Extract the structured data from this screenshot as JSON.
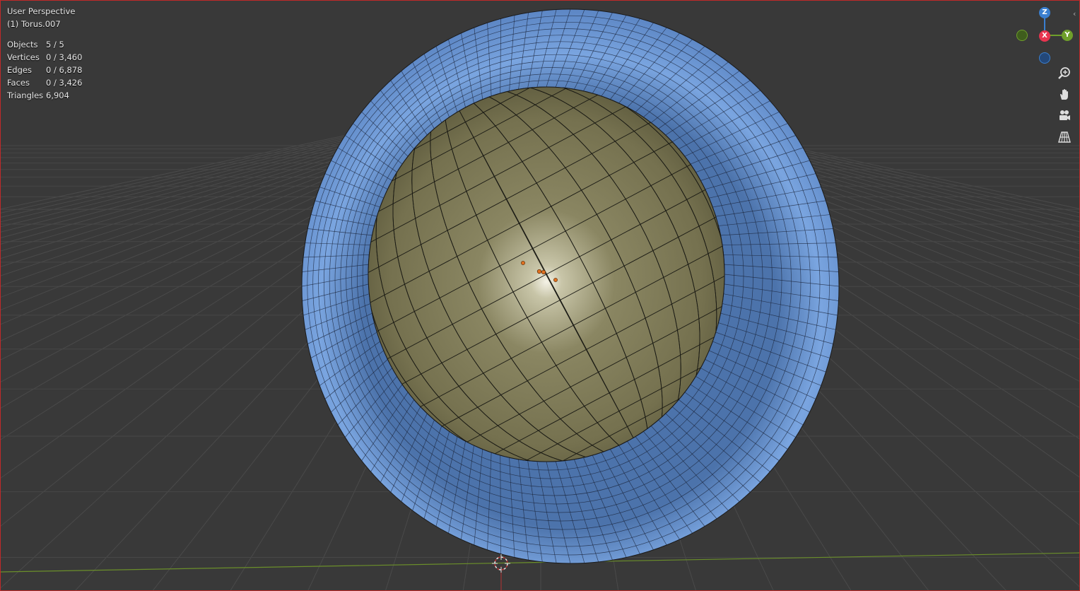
{
  "viewport": {
    "view_title": "User Perspective",
    "object_name": "(1) Torus.007",
    "stats": [
      {
        "label": "Objects",
        "value": "5 / 5"
      },
      {
        "label": "Vertices",
        "value": "0 / 3,460"
      },
      {
        "label": "Edges",
        "value": "0 / 6,878"
      },
      {
        "label": "Faces",
        "value": "0 / 3,426"
      },
      {
        "label": "Triangles",
        "value": "6,904"
      }
    ]
  },
  "gizmo": {
    "z_label": "Z",
    "x_label": "X",
    "y_label": "Y",
    "colors": {
      "x": "#e8344f",
      "y": "#6f9f2b",
      "z": "#3a7fd0"
    }
  },
  "nav_buttons": [
    "zoom-icon",
    "pan-hand-icon",
    "camera-icon",
    "grid-perspective-icon"
  ],
  "colors": {
    "background": "#393939",
    "torus": "#6f9ad8",
    "sphere": "#7c7856",
    "wire": "#1a1a1a",
    "border": "#c02a2a"
  }
}
